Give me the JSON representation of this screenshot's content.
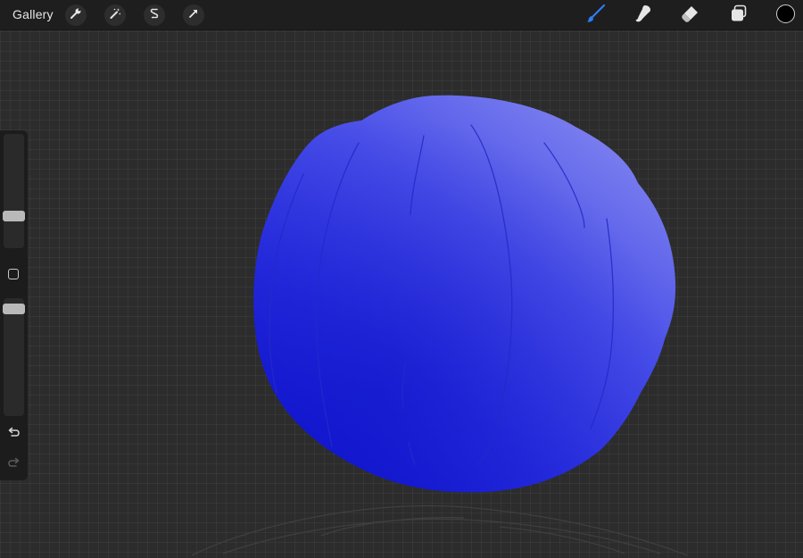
{
  "topbar": {
    "gallery_label": "Gallery",
    "actions_icon": "wrench-icon",
    "adjustments_icon": "magic-wand-icon",
    "selection_icon": "selection-s-icon",
    "transform_icon": "transform-arrow-icon",
    "brush_icon": "brush-icon",
    "smudge_icon": "smudge-icon",
    "eraser_icon": "eraser-icon",
    "layers_icon": "layers-icon",
    "current_color": "#000000",
    "active_tool_color": "#2f7cf6"
  },
  "sidebar": {
    "size_slider_icon": "slider-handle",
    "modify_icon": "square-modify-icon",
    "opacity_slider_icon": "slider-handle",
    "undo_icon": "undo-arrow-icon",
    "redo_icon": "redo-arrow-icon"
  },
  "canvas": {
    "background": "#2c2c2c",
    "blob_color_light": "#7a7ff0",
    "blob_color_mid": "#3f45e6",
    "blob_color_dark": "#1a1fd8"
  }
}
